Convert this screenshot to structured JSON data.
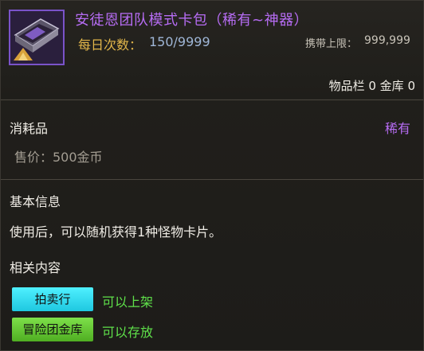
{
  "item": {
    "name": "安徒恩团队模式卡包（稀有~神器）",
    "daily_label": "每日次数：",
    "daily_value": "150/9999",
    "carry_label": "携带上限：",
    "carry_value": "999,999",
    "inventory_count": "物品栏 0 金库 0",
    "icon": "card-pack-icon"
  },
  "category": {
    "title": "消耗品",
    "rarity": "稀有",
    "price": "售价：500金币"
  },
  "basic_info": {
    "title": "基本信息",
    "description": "使用后，可以随机获得1种怪物卡片。"
  },
  "related": {
    "title": "相关内容",
    "auction_label": "拍卖行",
    "auction_note": "可以上架",
    "guild_label": "冒险团金库",
    "guild_note": "可以存放"
  },
  "colors": {
    "item_name": "#b66cf3",
    "daily_label": "#e2b64a",
    "auction_tag": "#4ff0ff",
    "guild_tag": "#7ee04a",
    "tag_note": "#5fe04a"
  }
}
